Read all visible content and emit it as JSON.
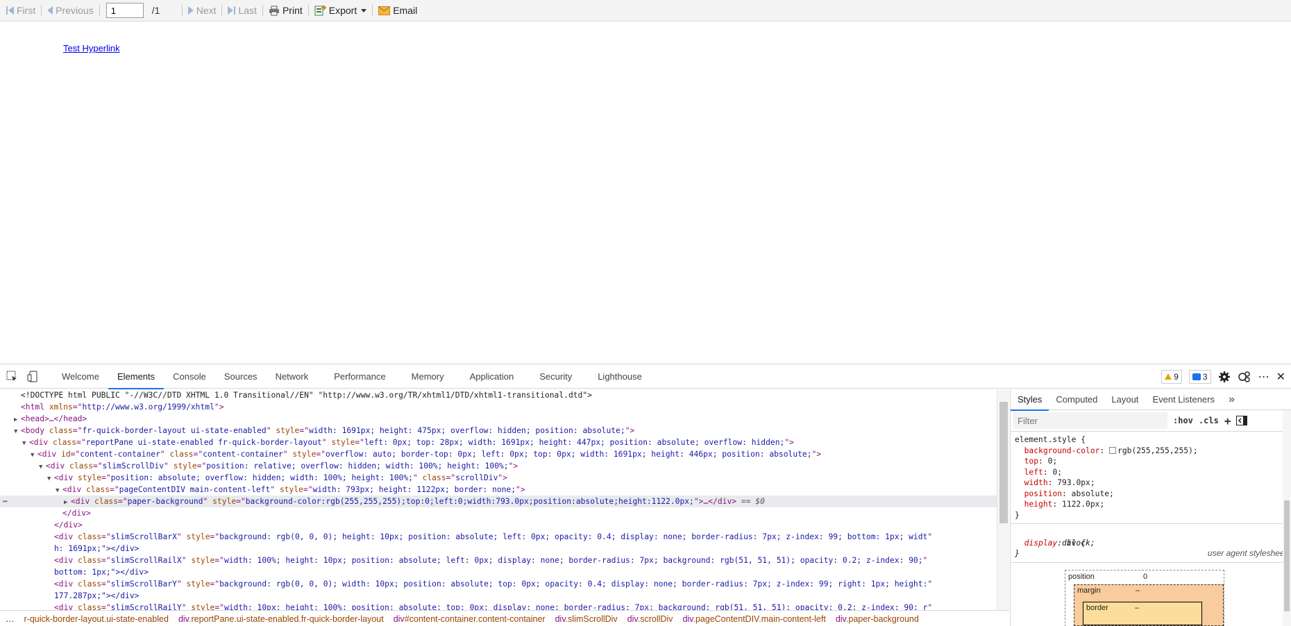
{
  "toolbar": {
    "first": "First",
    "previous": "Previous",
    "page_value": "1",
    "page_total": "/1",
    "next": "Next",
    "last": "Last",
    "print": "Print",
    "export": "Export",
    "email": "Email"
  },
  "report": {
    "link_text": "Test Hyperlink"
  },
  "devtools": {
    "tabs": [
      "Welcome",
      "Elements",
      "Console",
      "Sources",
      "Network",
      "Performance",
      "Memory",
      "Application",
      "Security",
      "Lighthouse"
    ],
    "warnings_count": "9",
    "messages_count": "3",
    "more_label": "⋯",
    "close_label": "✕",
    "styles_tabs": [
      "Styles",
      "Computed",
      "Layout",
      "Event Listeners"
    ],
    "styles_more": "»",
    "filter_placeholder": "Filter",
    "hov_label": ":hov",
    "cls_label": ".cls",
    "plus_label": "+",
    "rule1": {
      "selector": "element.style {",
      "props": [
        {
          "name": "background-color",
          "value": "rgb(255,255,255);",
          "swatch": true
        },
        {
          "name": "top",
          "value": "0;"
        },
        {
          "name": "left",
          "value": "0;"
        },
        {
          "name": "width",
          "value": "793.0px;"
        },
        {
          "name": "position",
          "value": "absolute;"
        },
        {
          "name": "height",
          "value": "1122.0px;"
        }
      ],
      "close": "}"
    },
    "rule2": {
      "selector": "div {",
      "source": "user agent stylesheet",
      "prop_name": "display",
      "prop_value": "block;",
      "close": "}"
    },
    "boxmodel": {
      "position_label": "position",
      "position_value": "0",
      "margin_label": "margin",
      "margin_value": "–",
      "border_label": "border",
      "border_value": "–"
    },
    "code_lines": [
      {
        "indent": 1,
        "tri": "",
        "html": "<!DOCTYPE html PUBLIC \"-//W3C//DTD XHTML 1.0 Transitional//EN\" \"http://www.w3.org/TR/xhtml1/DTD/xhtml1-transitional.dtd\">",
        "kind": "doctype"
      },
      {
        "indent": 1,
        "tri": "",
        "tagname": "html",
        "attrs": [
          [
            "xmlns",
            "http://www.w3.org/1999/xhtml"
          ]
        ],
        "end": ">"
      },
      {
        "indent": 1,
        "tri": "▶",
        "raw": "<head>…</head>"
      },
      {
        "indent": 1,
        "tri": "▼",
        "tagname": "body",
        "attrs": [
          [
            "class",
            "fr-quick-border-layout ui-state-enabled"
          ],
          [
            "style",
            "width: 1691px; height: 475px; overflow: hidden; position: absolute;"
          ]
        ],
        "end": ">"
      },
      {
        "indent": 2,
        "tri": "▼",
        "tagname": "div",
        "attrs": [
          [
            "class",
            "reportPane ui-state-enabled fr-quick-border-layout"
          ],
          [
            "style",
            "left: 0px; top: 28px; width: 1691px; height: 447px; position: absolute; overflow: hidden;"
          ]
        ],
        "end": ">"
      },
      {
        "indent": 3,
        "tri": "▼",
        "tagname": "div",
        "attrs": [
          [
            "id",
            "content-container"
          ],
          [
            "class",
            "content-container"
          ],
          [
            "style",
            "overflow: auto; border-top: 0px; left: 0px; top: 0px; width: 1691px; height: 446px; position: absolute;"
          ]
        ],
        "end": ">"
      },
      {
        "indent": 4,
        "tri": "▼",
        "tagname": "div",
        "attrs": [
          [
            "class",
            "slimScrollDiv"
          ],
          [
            "style",
            "position: relative; overflow: hidden; width: 100%; height: 100%;"
          ]
        ],
        "end": ">"
      },
      {
        "indent": 5,
        "tri": "▼",
        "tagname": "div",
        "attrs": [
          [
            "style",
            "position: absolute; overflow: hidden; width: 100%; height: 100%;"
          ],
          [
            "class",
            "scrollDiv"
          ]
        ],
        "end": ">"
      },
      {
        "indent": 6,
        "tri": "▼",
        "tagname": "div",
        "attrs": [
          [
            "class",
            "pageContentDIV main-content-left"
          ],
          [
            "style",
            "width: 793px; height: 1122px; border: none;"
          ]
        ],
        "end": ">"
      },
      {
        "indent": 7,
        "tri": "▶",
        "tagname": "div",
        "attrs": [
          [
            "class",
            "paper-background"
          ],
          [
            "style",
            "background-color:rgb(255,255,255);top:0;left:0;width:793.0px;position:absolute;height:1122.0px;"
          ]
        ],
        "end": ">…</div>",
        "tail": " == $0",
        "selected": true
      },
      {
        "indent": 6,
        "tri": "",
        "raw": "</div>"
      },
      {
        "indent": 5,
        "tri": "",
        "raw": "</div>"
      },
      {
        "indent": 5,
        "tri": "",
        "tagname": "div",
        "attrs": [
          [
            "class",
            "slimScrollBarX"
          ],
          [
            "style",
            "background: rgb(0, 0, 0); height: 10px; position: absolute; left: 0px; opacity: 0.4; display: none; border-radius: 7px; z-index: 99; bottom: 1px; widt"
          ]
        ],
        "end": ""
      },
      {
        "indent": 5,
        "tri": "",
        "wrap": "h: 1691px;\"></div>"
      },
      {
        "indent": 5,
        "tri": "",
        "tagname": "div",
        "attrs": [
          [
            "class",
            "slimScrollRailX"
          ],
          [
            "style",
            "width: 100%; height: 10px; position: absolute; left: 0px; display: none; border-radius: 7px; background: rgb(51, 51, 51); opacity: 0.2; z-index: 90;"
          ]
        ],
        "end": ""
      },
      {
        "indent": 5,
        "tri": "",
        "wrap": "bottom: 1px;\"></div>"
      },
      {
        "indent": 5,
        "tri": "",
        "tagname": "div",
        "attrs": [
          [
            "class",
            "slimScrollBarY"
          ],
          [
            "style",
            "background: rgb(0, 0, 0); width: 10px; position: absolute; top: 0px; opacity: 0.4; display: none; border-radius: 7px; z-index: 99; right: 1px; height:"
          ]
        ],
        "end": ""
      },
      {
        "indent": 5,
        "tri": "",
        "wrap": "177.287px;\"></div>"
      },
      {
        "indent": 5,
        "tri": "",
        "tagname": "div",
        "attrs": [
          [
            "class",
            "slimScrollRailY"
          ],
          [
            "style",
            "width: 10px; height: 100%; position: absolute; top: 0px; display: none; border-radius: 7px; background: rgb(51, 51, 51); opacity: 0.2; z-index: 90; r"
          ]
        ],
        "end": ""
      }
    ],
    "breadcrumbs": [
      {
        "tag": "",
        "cls": "r-quick-border-layout.ui-state-enabled"
      },
      {
        "tag": "div",
        "cls": ".reportPane.ui-state-enabled.fr-quick-border-layout"
      },
      {
        "tag": "div",
        "cls": "#content-container.content-container"
      },
      {
        "tag": "div",
        "cls": ".slimScrollDiv"
      },
      {
        "tag": "div",
        "cls": ".scrollDiv"
      },
      {
        "tag": "div",
        "cls": ".pageContentDIV.main-content-left"
      },
      {
        "tag": "div",
        "cls": ".paper-background"
      }
    ],
    "crumb_ellipsis": "…",
    "gutter_dots": "⋯"
  }
}
